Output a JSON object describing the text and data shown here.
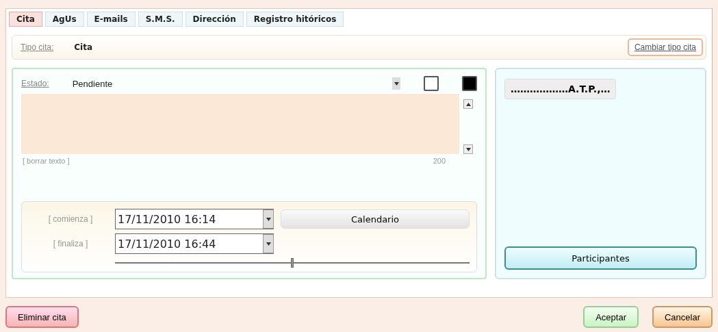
{
  "tabs": [
    {
      "label": "Cita",
      "selected": true
    },
    {
      "label": "AgUs",
      "selected": false
    },
    {
      "label": "E-mails",
      "selected": false
    },
    {
      "label": "S.M.S.",
      "selected": false
    },
    {
      "label": "Dirección",
      "selected": false
    },
    {
      "label": "Registro hitóricos",
      "selected": false
    }
  ],
  "tipo": {
    "label": "Tipo cita:",
    "value": "Cita",
    "button": "Cambiar tipo cita"
  },
  "estado": {
    "label": "Estado:",
    "value": "Pendiente",
    "colors": [
      {
        "color": "#ffffff"
      },
      {
        "color": "#000000"
      }
    ]
  },
  "note": {
    "clear_link": "[ borrar texto ]",
    "counter": "200"
  },
  "times": {
    "start_label": "[ comienza ]",
    "start": "17/11/2010 16:14",
    "end_label": "[ finaliza ]",
    "end": "17/11/2010 16:44",
    "calendar_button": "Calendario",
    "duration": {
      "level": 0.5
    }
  },
  "participants": {
    "chip": "………………A.T.P.,…",
    "button": "Participantes"
  },
  "footer": {
    "delete": "Eliminar cita",
    "accept": "Aceptar",
    "cancel": "Cancelar"
  }
}
